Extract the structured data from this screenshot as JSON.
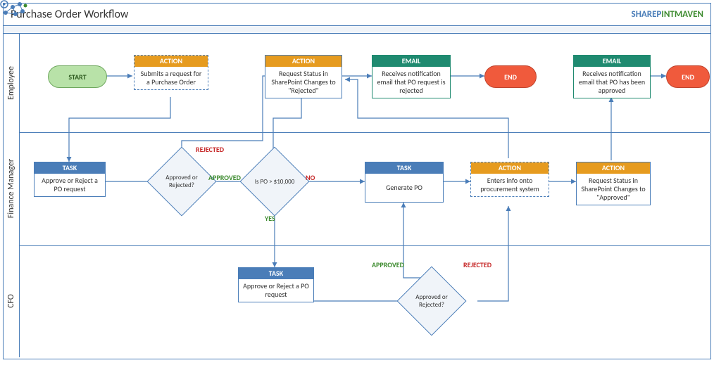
{
  "title": "Purchase Order Workflow",
  "logo": {
    "part1": "SHAREP",
    "part2": "INTMAVEN"
  },
  "lanes": {
    "employee": "Employee",
    "finance": "Finance Manager",
    "cfo": "CFO"
  },
  "nodes": {
    "start": "START",
    "emp_action1": {
      "hdr": "ACTION",
      "body": "Submits a request for a Purchase Order"
    },
    "emp_action2": {
      "hdr": "ACTION",
      "body": "Request Status in SharePoint Changes to \"Rejected\""
    },
    "emp_email1": {
      "hdr": "EMAIL",
      "body": "Receives notification email that PO request is rejected"
    },
    "end1": "END",
    "emp_email2": {
      "hdr": "EMAIL",
      "body": "Receives notification email that PO has been approved"
    },
    "end2": "END",
    "fin_task1": {
      "hdr": "TASK",
      "body": "Approve or Reject a PO request"
    },
    "fin_dec1": "Approved or Rejected?",
    "fin_dec2": "Is PO > $10,000",
    "fin_task2": {
      "hdr": "TASK",
      "body": "Generate PO"
    },
    "fin_action1": {
      "hdr": "ACTION",
      "body": "Enters info onto procurement system"
    },
    "fin_action2": {
      "hdr": "ACTION",
      "body": "Request Status in SharePoint Changes to \"Approved\""
    },
    "cfo_task": {
      "hdr": "TASK",
      "body": "Approve or Reject a PO request"
    },
    "cfo_dec": "Approved or Rejected?"
  },
  "labels": {
    "rejected1": "REJECTED",
    "approved1": "APPROVED",
    "yes": "YES",
    "no": "NO",
    "approved2": "APPROVED",
    "rejected2": "REJECTED"
  }
}
